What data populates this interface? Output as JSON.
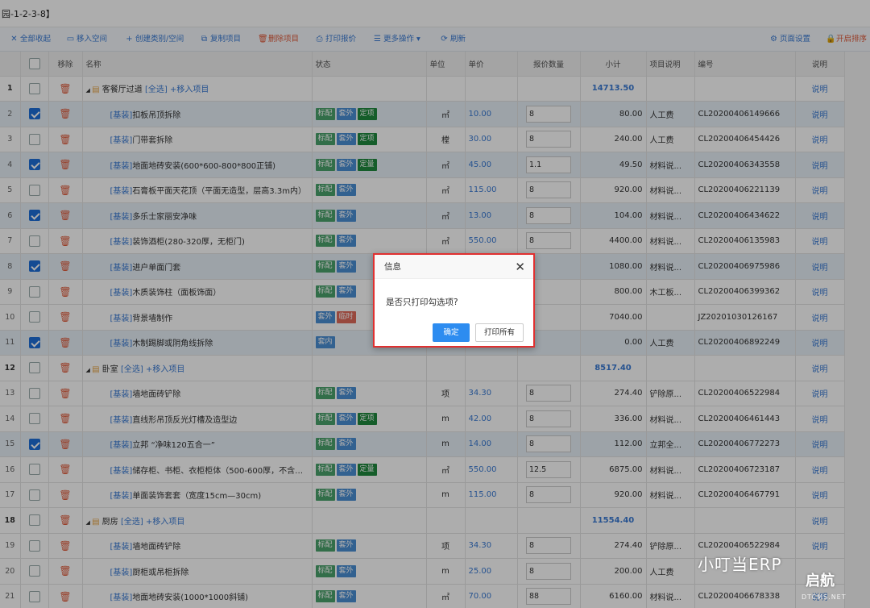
{
  "breadcrumb": "园-1-2-3-8】",
  "toolbar": {
    "collapse_all": "全部收起",
    "move_space": "移入空间",
    "create_category": "创建类别/空间",
    "copy_item": "复制项目",
    "delete_item": "删除项目",
    "print_quote": "打印报价",
    "more_actions": "更多操作",
    "refresh": "刷新",
    "page_settings": "页面设置",
    "enable_sort": "开启排序"
  },
  "columns": {
    "remove": "移除",
    "name": "名称",
    "status": "状态",
    "unit": "单位",
    "price": "单价",
    "qty": "报价数量",
    "subtotal": "小计",
    "desc": "项目说明",
    "code": "编号",
    "note": "说明"
  },
  "rows": [
    {
      "no": "1",
      "group": true,
      "name": "客餐厅过道",
      "select_all": "[全选]",
      "add_item": "+移入项目",
      "subtotal": "14713.50",
      "note": "说明"
    },
    {
      "no": "2",
      "checked": true,
      "prefix": "[基装]",
      "name": "扣板吊顶拆除",
      "tags": [
        {
          "t": "标配",
          "c": "g"
        },
        {
          "t": "套外",
          "c": "b"
        },
        {
          "t": "定项",
          "c": "dg"
        }
      ],
      "unit": "㎡",
      "price": "10.00",
      "qty": "8",
      "subtotal": "80.00",
      "desc": "人工费",
      "code": "CL20200406149666",
      "note": "说明"
    },
    {
      "no": "3",
      "checked": false,
      "prefix": "[基装]",
      "name": "门带套拆除",
      "tags": [
        {
          "t": "标配",
          "c": "g"
        },
        {
          "t": "套外",
          "c": "b"
        },
        {
          "t": "定项",
          "c": "dg"
        }
      ],
      "unit": "樘",
      "price": "30.00",
      "qty": "8",
      "subtotal": "240.00",
      "desc": "人工费",
      "code": "CL20200406454426",
      "note": "说明"
    },
    {
      "no": "4",
      "checked": true,
      "prefix": "[基装]",
      "name": "地面地砖安装(600*600-800*800正铺)",
      "tags": [
        {
          "t": "标配",
          "c": "g"
        },
        {
          "t": "套外",
          "c": "b"
        },
        {
          "t": "定量",
          "c": "dg"
        }
      ],
      "unit": "㎡",
      "price": "45.00",
      "qty": "1.1",
      "subtotal": "49.50",
      "desc": "材料说...",
      "code": "CL20200406343558",
      "note": "说明"
    },
    {
      "no": "5",
      "checked": false,
      "prefix": "[基装]",
      "name": "石膏板平面天花顶（平面无造型，层高3.3m内）",
      "tags": [
        {
          "t": "标配",
          "c": "g"
        },
        {
          "t": "套外",
          "c": "b"
        }
      ],
      "unit": "㎡",
      "price": "115.00",
      "qty": "8",
      "subtotal": "920.00",
      "desc": "材料说...",
      "code": "CL20200406221139",
      "note": "说明"
    },
    {
      "no": "6",
      "checked": true,
      "prefix": "[基装]",
      "name": "多乐士家丽安净味",
      "tags": [
        {
          "t": "标配",
          "c": "g"
        },
        {
          "t": "套外",
          "c": "b"
        }
      ],
      "unit": "㎡",
      "price": "13.00",
      "qty": "8",
      "subtotal": "104.00",
      "desc": "材料说...",
      "code": "CL20200406434622",
      "note": "说明"
    },
    {
      "no": "7",
      "checked": false,
      "prefix": "[基装]",
      "name": "装饰酒柜(280-320厚，无柜门)",
      "tags": [
        {
          "t": "标配",
          "c": "g"
        },
        {
          "t": "套外",
          "c": "b"
        }
      ],
      "unit": "㎡",
      "price": "550.00",
      "qty": "8",
      "subtotal": "4400.00",
      "desc": "材料说...",
      "code": "CL20200406135983",
      "note": "说明"
    },
    {
      "no": "8",
      "checked": true,
      "prefix": "[基装]",
      "name": "进户单面门套",
      "tags": [
        {
          "t": "标配",
          "c": "g"
        },
        {
          "t": "套外",
          "c": "b"
        }
      ],
      "unit": "",
      "price": "",
      "qty": "",
      "subtotal": "1080.00",
      "desc": "材料说...",
      "code": "CL20200406975986",
      "note": "说明"
    },
    {
      "no": "9",
      "checked": false,
      "prefix": "[基装]",
      "name": "木质装饰柱（面板饰面）",
      "tags": [
        {
          "t": "标配",
          "c": "g"
        },
        {
          "t": "套外",
          "c": "b"
        }
      ],
      "unit": "",
      "price": "",
      "qty": "",
      "subtotal": "800.00",
      "desc": "木工板...",
      "code": "CL20200406399362",
      "note": "说明"
    },
    {
      "no": "10",
      "checked": false,
      "prefix": "[基装]",
      "name": "背景墙制作",
      "tags": [
        {
          "t": "套外",
          "c": "b"
        },
        {
          "t": "临时",
          "c": "rd"
        }
      ],
      "unit": "",
      "price": "",
      "qty": "",
      "subtotal": "7040.00",
      "desc": "",
      "code": "JZ20201030126167",
      "note": "说明"
    },
    {
      "no": "11",
      "checked": true,
      "prefix": "[基装]",
      "name": "木制踢脚或阴角线拆除",
      "tags": [
        {
          "t": "套内",
          "c": "b"
        }
      ],
      "unit": "",
      "price": "",
      "qty": "",
      "subtotal": "0.00",
      "desc": "人工费",
      "code": "CL20200406892249",
      "note": "说明"
    },
    {
      "no": "12",
      "group": true,
      "name": "卧室",
      "select_all": "[全选]",
      "add_item": "+移入项目",
      "subtotal": "8517.40",
      "note": "说明"
    },
    {
      "no": "13",
      "checked": false,
      "prefix": "[基装]",
      "name": "墙地面砖铲除",
      "tags": [
        {
          "t": "标配",
          "c": "g"
        },
        {
          "t": "套外",
          "c": "b"
        }
      ],
      "unit": "项",
      "price": "34.30",
      "qty": "8",
      "subtotal": "274.40",
      "desc": "铲除原...",
      "code": "CL20200406522984",
      "note": "说明"
    },
    {
      "no": "14",
      "checked": false,
      "prefix": "[基装]",
      "name": "直线形吊顶反光灯槽及造型边",
      "tags": [
        {
          "t": "标配",
          "c": "g"
        },
        {
          "t": "套外",
          "c": "b"
        },
        {
          "t": "定项",
          "c": "dg"
        }
      ],
      "unit": "m",
      "price": "42.00",
      "qty": "8",
      "subtotal": "336.00",
      "desc": "材料说...",
      "code": "CL20200406461443",
      "note": "说明"
    },
    {
      "no": "15",
      "checked": true,
      "prefix": "[基装]",
      "name": "立邦 “净味120五合一”",
      "tags": [
        {
          "t": "标配",
          "c": "g"
        },
        {
          "t": "套外",
          "c": "b"
        }
      ],
      "unit": "m",
      "price": "14.00",
      "qty": "8",
      "subtotal": "112.00",
      "desc": "立邦全...",
      "code": "CL20200406772273",
      "note": "说明"
    },
    {
      "no": "16",
      "checked": false,
      "prefix": "[基装]",
      "name": "储存柜、书柜、衣柜柜体（500-600厚，不含柜门…",
      "tags": [
        {
          "t": "标配",
          "c": "g"
        },
        {
          "t": "套外",
          "c": "b"
        },
        {
          "t": "定量",
          "c": "dg"
        }
      ],
      "unit": "㎡",
      "price": "550.00",
      "qty": "12.5",
      "subtotal": "6875.00",
      "desc": "材料说...",
      "code": "CL20200406723187",
      "note": "说明"
    },
    {
      "no": "17",
      "checked": false,
      "prefix": "[基装]",
      "name": "单面装饰套套（宽度15cm—30cm)",
      "tags": [
        {
          "t": "标配",
          "c": "g"
        },
        {
          "t": "套外",
          "c": "b"
        }
      ],
      "unit": "m",
      "price": "115.00",
      "qty": "8",
      "subtotal": "920.00",
      "desc": "材料说...",
      "code": "CL20200406467791",
      "note": "说明"
    },
    {
      "no": "18",
      "group": true,
      "name": "厨房",
      "select_all": "[全选]",
      "add_item": "+移入项目",
      "subtotal": "11554.40",
      "note": "说明"
    },
    {
      "no": "19",
      "checked": false,
      "prefix": "[基装]",
      "name": "墙地面砖铲除",
      "tags": [
        {
          "t": "标配",
          "c": "g"
        },
        {
          "t": "套外",
          "c": "b"
        }
      ],
      "unit": "项",
      "price": "34.30",
      "qty": "8",
      "subtotal": "274.40",
      "desc": "铲除原...",
      "code": "CL20200406522984",
      "note": "说明"
    },
    {
      "no": "20",
      "checked": false,
      "prefix": "[基装]",
      "name": "厨柜或吊柜拆除",
      "tags": [
        {
          "t": "标配",
          "c": "g"
        },
        {
          "t": "套外",
          "c": "b"
        }
      ],
      "unit": "m",
      "price": "25.00",
      "qty": "8",
      "subtotal": "200.00",
      "desc": "人工费",
      "code": "",
      "note": ""
    },
    {
      "no": "21",
      "checked": false,
      "prefix": "[基装]",
      "name": "地面地砖安装(1000*1000斜铺)",
      "tags": [
        {
          "t": "标配",
          "c": "g"
        },
        {
          "t": "套外",
          "c": "b"
        }
      ],
      "unit": "㎡",
      "price": "70.00",
      "qty": "88",
      "subtotal": "6160.00",
      "desc": "材料说...",
      "code": "CL20200406678338",
      "note": "说明"
    }
  ],
  "dialog": {
    "title": "信息",
    "message": "是否只打印勾选项?",
    "ok": "确定",
    "print_all": "打印所有"
  },
  "watermark": {
    "text1": "小叮当ERP",
    "text2": "启航",
    "text3": "DTCMS.NET"
  }
}
